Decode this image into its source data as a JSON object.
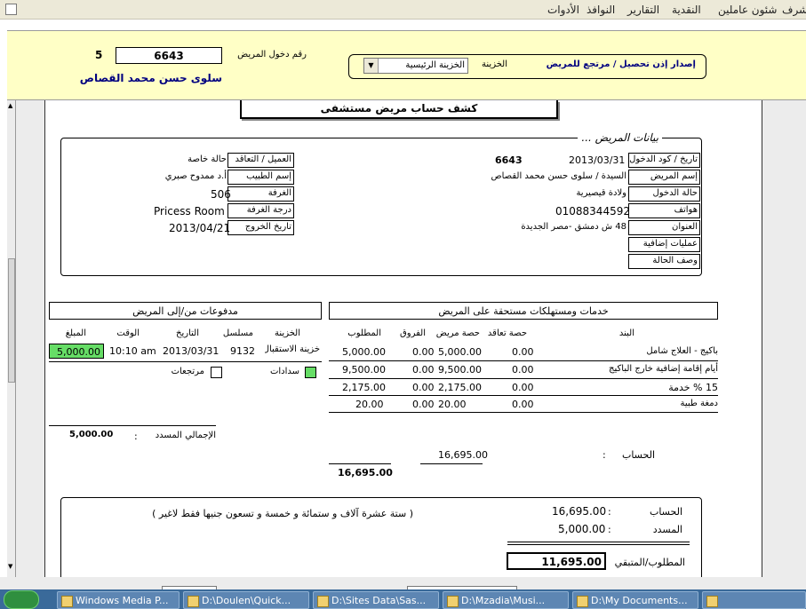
{
  "menu": {
    "m1": "شرف",
    "m2": "شئون عاملين",
    "m3": "النقدية",
    "m4": "التقارير",
    "m5": "النوافذ",
    "m6": "الأدوات"
  },
  "header": {
    "action_label": "إصدار إذن تحصيل / مرتجع للمريض",
    "treasury_label": "الخزينة",
    "treasury_value": "الخزينة الرئيسية",
    "admission_no_label": "رقم دخول المريض",
    "admission_no": "6643",
    "count": "5",
    "patient_name": "سلوى حسن محمد القصاص"
  },
  "report": {
    "title": "كشف حساب مريض مستشفى",
    "patient_section": "بيانات المريض ...",
    "left_fields": [
      {
        "label": "تاريخ / كود الدخول",
        "value": "2013/03/31",
        "code": "6643"
      },
      {
        "label": "إسم المريض",
        "value": "السيدة / سلوى حسن محمد القصاص"
      },
      {
        "label": "حالة الدخول",
        "value": "ولادة قيصيرية"
      },
      {
        "label": "هواتف",
        "value": "01088344592"
      },
      {
        "label": "العنوان",
        "value": "48 ش دمشق -مصر الجديدة"
      },
      {
        "label": "عمليات إضافية",
        "value": ""
      },
      {
        "label": "وصف الحالة",
        "value": ""
      }
    ],
    "right_fields": [
      {
        "label": "العميل / التعاقد",
        "value": "حالة خاصة"
      },
      {
        "label": "إسم الطبيب",
        "value": "أ.د ممدوح صبري"
      },
      {
        "label": "الغرفة",
        "value": "506"
      },
      {
        "label": "درجة الغرفة",
        "value": "Pricess Room"
      },
      {
        "label": "تاريخ الخروج",
        "value": "2013/04/21"
      }
    ],
    "services": {
      "title": "خدمات ومستهلكات مستحقة على المريض",
      "headers": {
        "item": "البند",
        "contract": "حصة تعاقد",
        "patient": "حصة مريض",
        "diff": "الفروق",
        "required": "المطلوب"
      },
      "rows": [
        {
          "item": "باكيج - العلاج شامل",
          "contract": "0.00",
          "patient": "5,000.00",
          "diff": "0.00",
          "required": "5,000.00"
        },
        {
          "item": "أيام إقامة إضافية خارج الباكيج",
          "contract": "0.00",
          "patient": "9,500.00",
          "diff": "0.00",
          "required": "9,500.00"
        },
        {
          "item": "15 %  خدمة",
          "contract": "0.00",
          "patient": "2,175.00",
          "diff": "0.00",
          "required": "2,175.00"
        },
        {
          "item": "دمغة طبية",
          "contract": "0.00",
          "patient": "20.00",
          "diff": "0.00",
          "required": "20.00"
        }
      ],
      "account_label": "الحساب",
      "colon": ":",
      "account_patient_total": "16,695.00",
      "account_required_total": "16,695.00"
    },
    "payments": {
      "title": "مدفوعات من/إلى المريض",
      "headers": {
        "treasury": "الخزينة",
        "serial": "مسلسل",
        "date": "التاريخ",
        "time": "الوقت",
        "amount": "المبلغ"
      },
      "row": {
        "treasury": "خزينة الاستقبال",
        "serial": "9132",
        "date": "2013/03/31",
        "time": "10:10 am",
        "amount": "5,000.00"
      },
      "payments_label": "سدادات",
      "returns_label": "مرتجعات",
      "total_label": "الإجمالي المسدد",
      "colon": ":",
      "total_value": "5,000.00"
    },
    "summary": {
      "words": "( ستة عشرة آلاف و ستمائة و خمسة و تسعون جنيها فقط لاغير )",
      "account_label": "الحساب",
      "account_value": "16,695.00",
      "paid_label": "المسدد",
      "paid_value": "5,000.00",
      "remaining_label": "المطلوب/المتبقي",
      "remaining_value": "11,695.00",
      "colon": ":"
    }
  },
  "taskbar": {
    "items": [
      "Windows Media P...",
      "D:\\Doulen\\Quick...",
      "D:\\Sites Data\\Sas...",
      "D:\\Mzadia\\Musi...",
      "D:\\My Documents..."
    ]
  },
  "colors": {
    "menu_bg": "#ece9d8",
    "header_bg": "#ffffc6",
    "nav_text": "#000080",
    "accent_green": "#66dd66"
  }
}
